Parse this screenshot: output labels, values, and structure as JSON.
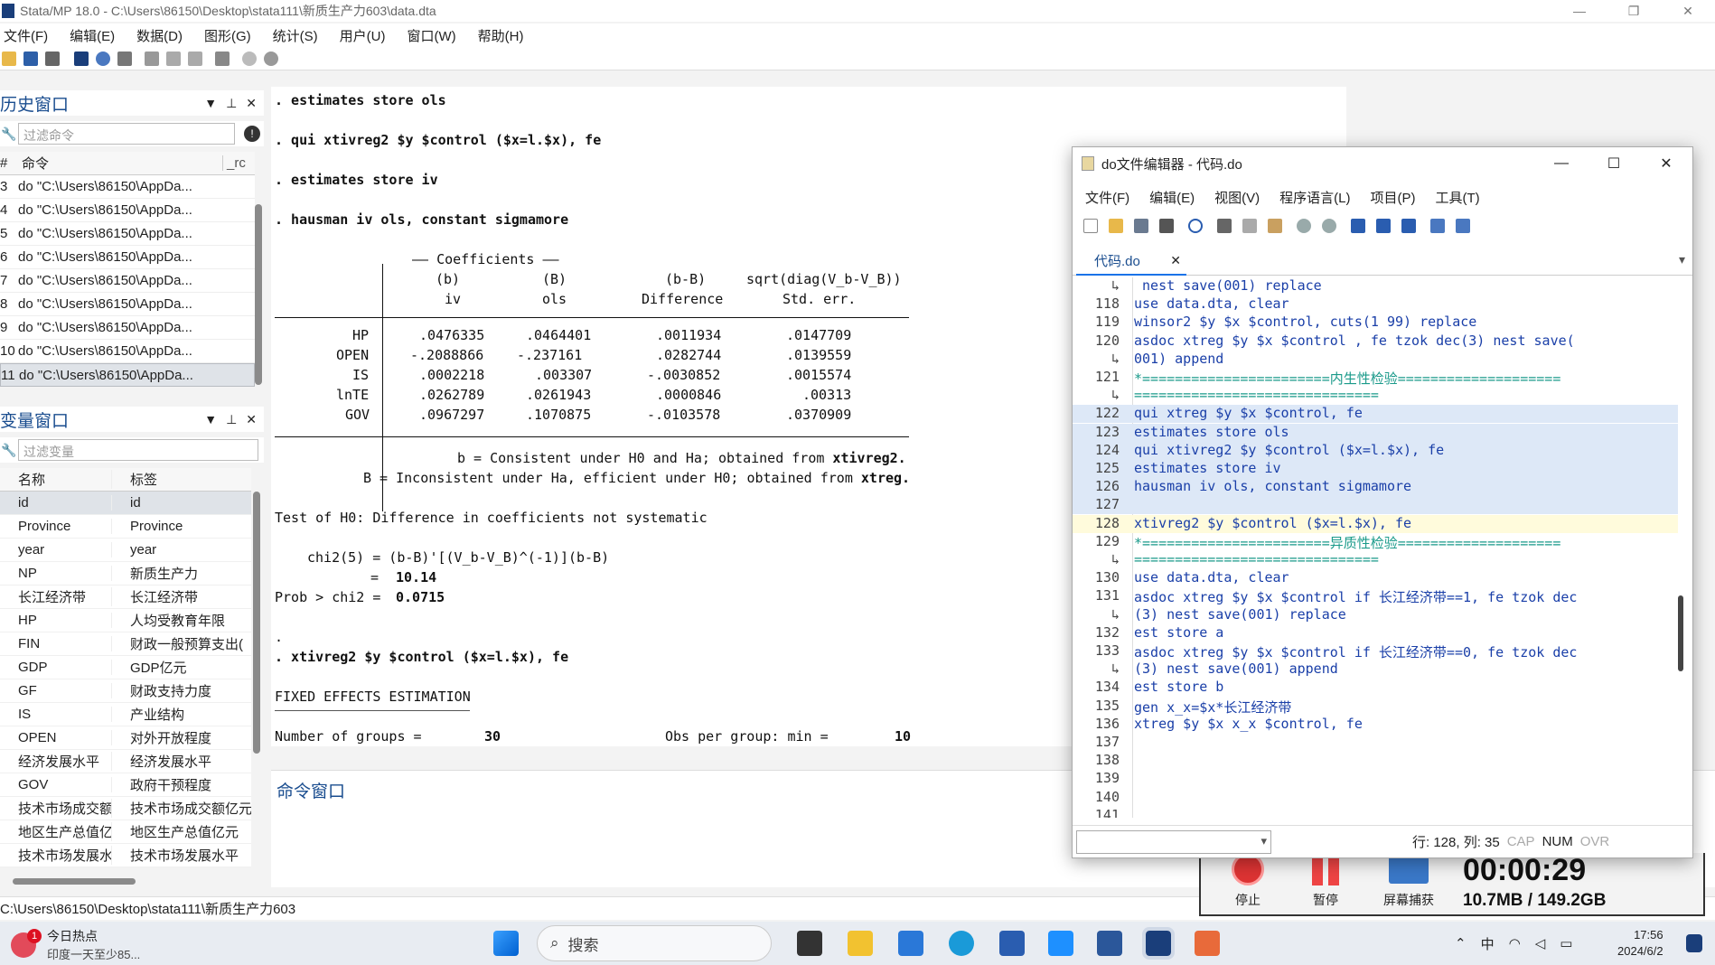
{
  "window": {
    "title": "Stata/MP 18.0 - C:\\Users\\86150\\Desktop\\stata111\\新质生产力603\\data.dta",
    "minimize": "—",
    "restore": "❐",
    "close": "✕"
  },
  "menu": [
    "文件(F)",
    "编辑(E)",
    "数据(D)",
    "图形(G)",
    "统计(S)",
    "用户(U)",
    "窗口(W)",
    "帮助(H)"
  ],
  "history": {
    "title": "历史窗口",
    "filter_placeholder": "过滤命令",
    "col_num": "#",
    "col_cmd": "命令",
    "col_rc": "_rc",
    "rows": [
      {
        "n": "3",
        "cmd": "do \"C:\\Users\\86150\\AppDa..."
      },
      {
        "n": "4",
        "cmd": "do \"C:\\Users\\86150\\AppDa..."
      },
      {
        "n": "5",
        "cmd": "do \"C:\\Users\\86150\\AppDa..."
      },
      {
        "n": "6",
        "cmd": "do \"C:\\Users\\86150\\AppDa..."
      },
      {
        "n": "7",
        "cmd": "do \"C:\\Users\\86150\\AppDa..."
      },
      {
        "n": "8",
        "cmd": "do \"C:\\Users\\86150\\AppDa..."
      },
      {
        "n": "9",
        "cmd": "do \"C:\\Users\\86150\\AppDa..."
      },
      {
        "n": "10",
        "cmd": "do \"C:\\Users\\86150\\AppDa..."
      },
      {
        "n": "11",
        "cmd": "do \"C:\\Users\\86150\\AppDa..."
      }
    ]
  },
  "variables": {
    "title": "变量窗口",
    "filter_placeholder": "过滤变量",
    "col_name": "名称",
    "col_label": "标签",
    "rows": [
      {
        "name": "id",
        "label": "id"
      },
      {
        "name": "Province",
        "label": "Province"
      },
      {
        "name": "year",
        "label": "year"
      },
      {
        "name": "NP",
        "label": "新质生产力"
      },
      {
        "name": "长江经济带",
        "label": "长江经济带"
      },
      {
        "name": "HP",
        "label": "人均受教育年限"
      },
      {
        "name": "FIN",
        "label": "财政一般预算支出("
      },
      {
        "name": "GDP",
        "label": "GDP亿元"
      },
      {
        "name": "GF",
        "label": "财政支持力度"
      },
      {
        "name": "IS",
        "label": "产业结构"
      },
      {
        "name": "OPEN",
        "label": "对外开放程度"
      },
      {
        "name": "经济发展水平",
        "label": "经济发展水平"
      },
      {
        "name": "GOV",
        "label": "政府干预程度"
      },
      {
        "name": "技术市场成交额...",
        "label": "技术市场成交额亿元"
      },
      {
        "name": "地区生产总值亿...",
        "label": "地区生产总值亿元"
      },
      {
        "name": "技术市场发展水...",
        "label": "技术市场发展水平"
      }
    ]
  },
  "results": {
    "lines": [
      ". estimates store ols",
      ". qui xtivreg2 $y $control ($x=l.$x), fe",
      ". estimates store iv",
      ". hausman iv ols, constant sigmamore"
    ],
    "coef_header": "—— Coefficients ——",
    "col_heads": [
      "(b)",
      "(B)",
      "(b-B)",
      "sqrt(diag(V_b-V_B))"
    ],
    "col_subheads": [
      "iv",
      "ols",
      "Difference",
      "Std. err."
    ],
    "table": [
      {
        "var": "HP",
        "b": ".0476335",
        "B": ".0464401",
        "diff": ".0011934",
        "se": ".0147709"
      },
      {
        "var": "OPEN",
        "b": "-.2088866",
        "B": "-.237161",
        "diff": ".0282744",
        "se": ".0139559"
      },
      {
        "var": "IS",
        "b": ".0002218",
        "B": ".003307",
        "diff": "-.0030852",
        "se": ".0015574"
      },
      {
        "var": "lnTE",
        "b": ".0262789",
        "B": ".0261943",
        "diff": ".0000846",
        "se": ".00313"
      },
      {
        "var": "GOV",
        "b": ".0967297",
        "B": ".1070875",
        "diff": "-.0103578",
        "se": ".0370909"
      }
    ],
    "note1_pre": "b = Consistent under H0 and Ha; obtained from ",
    "note1_bold": "xtivreg2.",
    "note2_pre": "B = Inconsistent under Ha, efficient under H0; obtained from ",
    "note2_bold": "xtreg.",
    "test": "Test of H0: Difference in coefficients not systematic",
    "chi_formula": "chi2(5) = (b-B)'[(V_b-V_B)^(-1)](b-B)",
    "chi_eq": "=",
    "chi_value": "10.14",
    "prob_label": "Prob > chi2 =",
    "prob_value": "0.0715",
    "dot": ".",
    "xtivreg_cmd": ". xtivreg2 $y $control ($x=l.$x), fe",
    "fe_title": "FIXED EFFECTS ESTIMATION",
    "groups_label": "Number of groups =",
    "groups_value": "30",
    "obs_label": "Obs per group: min =",
    "obs_value": "10"
  },
  "command_window": {
    "title": "命令窗口"
  },
  "statusbar": {
    "path": "C:\\Users\\86150\\Desktop\\stata111\\新质生产力603"
  },
  "capture": {
    "stop": "停止",
    "pause": "暂停",
    "screen": "屏幕捕获",
    "timer": "00:00:29",
    "size": "10.7MB / 149.2GB"
  },
  "doeditor": {
    "title": "do文件编辑器 - 代码.do",
    "menu": [
      "文件(F)",
      "编辑(E)",
      "视图(V)",
      "程序语言(L)",
      "项目(P)",
      "工具(T)"
    ],
    "tab": "代码.do",
    "lines": [
      {
        "n": "↳",
        "t": " nest save(001) replace",
        "c": "pl"
      },
      {
        "n": "118",
        "t": "use data.dta, clear",
        "c": "pl"
      },
      {
        "n": "119",
        "t": "winsor2 $y $x $control, cuts(1 99) replace",
        "c": "pl"
      },
      {
        "n": "120",
        "t": "asdoc xtreg $y $x $control , fe tzok dec(3) nest save(",
        "c": "pl"
      },
      {
        "n": "↳",
        "t": "001) append",
        "c": "pl"
      },
      {
        "n": "121",
        "t": "*=======================内生性检验====================",
        "c": "cm"
      },
      {
        "n": "↳",
        "t": "==============================",
        "c": "cm"
      },
      {
        "n": "122",
        "t": "qui xtreg $y $x $control, fe",
        "c": "hl"
      },
      {
        "n": "123",
        "t": "estimates store ols",
        "c": "hl"
      },
      {
        "n": "124",
        "t": "qui xtivreg2 $y $control ($x=l.$x), fe",
        "c": "hl"
      },
      {
        "n": "125",
        "t": "estimates store iv",
        "c": "hl"
      },
      {
        "n": "126",
        "t": "hausman iv ols, constant sigmamore",
        "c": "hl"
      },
      {
        "n": "127",
        "t": "",
        "c": "hl"
      },
      {
        "n": "128",
        "t": "xtivreg2 $y $control ($x=l.$x), fe",
        "c": "cur"
      },
      {
        "n": "129",
        "t": "*=======================异质性检验====================",
        "c": "cm"
      },
      {
        "n": "↳",
        "t": "==============================",
        "c": "cm"
      },
      {
        "n": "130",
        "t": "use data.dta, clear",
        "c": "pl"
      },
      {
        "n": "131",
        "t": "asdoc xtreg $y $x $control if 长江经济带==1, fe tzok dec",
        "c": "pl"
      },
      {
        "n": "↳",
        "t": "(3) nest save(001) replace",
        "c": "pl"
      },
      {
        "n": "132",
        "t": "est store a",
        "c": "pl"
      },
      {
        "n": "133",
        "t": "asdoc xtreg $y $x $control if 长江经济带==0, fe tzok dec",
        "c": "pl"
      },
      {
        "n": "↳",
        "t": "(3) nest save(001) append",
        "c": "pl"
      },
      {
        "n": "134",
        "t": "est store b",
        "c": "pl"
      },
      {
        "n": "135",
        "t": "gen x_x=$x*长江经济带",
        "c": "pl"
      },
      {
        "n": "136",
        "t": "xtreg $y $x x_x $control, fe",
        "c": "pl"
      },
      {
        "n": "137",
        "t": "",
        "c": "pl"
      },
      {
        "n": "138",
        "t": "",
        "c": "pl"
      },
      {
        "n": "139",
        "t": "",
        "c": "pl"
      },
      {
        "n": "140",
        "t": "",
        "c": "pl"
      },
      {
        "n": "141",
        "t": "",
        "c": "pl"
      }
    ],
    "status_pos": "行: 128, 列: 35",
    "cap": "CAP",
    "num": "NUM",
    "ovr": "OVR"
  },
  "taskbar": {
    "news_title": "今日热点",
    "news_sub": "印度一天至少85...",
    "news_badge": "1",
    "search": "搜索",
    "ime": "中",
    "time": "17:56",
    "date": "2024/6/2"
  }
}
